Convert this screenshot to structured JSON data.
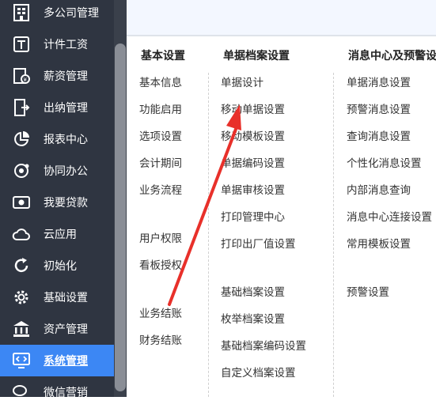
{
  "sidebar": {
    "items": [
      {
        "label": "多公司管理",
        "icon": "building-icon"
      },
      {
        "label": "计件工资",
        "icon": "piecework-icon"
      },
      {
        "label": "薪资管理",
        "icon": "salary-icon"
      },
      {
        "label": "出纳管理",
        "icon": "cashier-icon"
      },
      {
        "label": "报表中心",
        "icon": "pie-chart-icon"
      },
      {
        "label": "协同办公",
        "icon": "collaboration-icon"
      },
      {
        "label": "我要贷款",
        "icon": "loan-icon"
      },
      {
        "label": "云应用",
        "icon": "cloud-icon"
      },
      {
        "label": "初始化",
        "icon": "refresh-icon"
      },
      {
        "label": "基础设置",
        "icon": "gear-icon"
      },
      {
        "label": "资产管理",
        "icon": "bank-icon"
      },
      {
        "label": "系统管理",
        "icon": "code-monitor-icon",
        "active": true
      },
      {
        "label": "微信营销",
        "icon": "wechat-icon"
      }
    ],
    "active_color": "#3c87f4",
    "bg_color": "#2f3541"
  },
  "columns": [
    {
      "header": "基本设置",
      "links": [
        "基本信息",
        "功能启用",
        "选项设置",
        "会计期间",
        "业务流程",
        "用户权限",
        "看板授权",
        "业务结账",
        "财务结账"
      ]
    },
    {
      "header": "单据档案设置",
      "links": [
        "单据设计",
        "移动单据设置",
        "移动模板设置",
        "单据编码设置",
        "单据审核设置",
        "打印管理中心",
        "打印出厂值设置",
        "基础档案设置",
        "枚举档案设置",
        "基础档案编码设置",
        "自定义档案设置"
      ]
    },
    {
      "header": "消息中心及预警设",
      "links": [
        "单据消息设置",
        "预警消息设置",
        "查询消息设置",
        "个性化消息设置",
        "内部消息查询",
        "消息中心连接设置",
        "常用模板设置",
        "预警设置"
      ]
    }
  ],
  "annotation": {
    "arrow_color": "#e8302a"
  }
}
